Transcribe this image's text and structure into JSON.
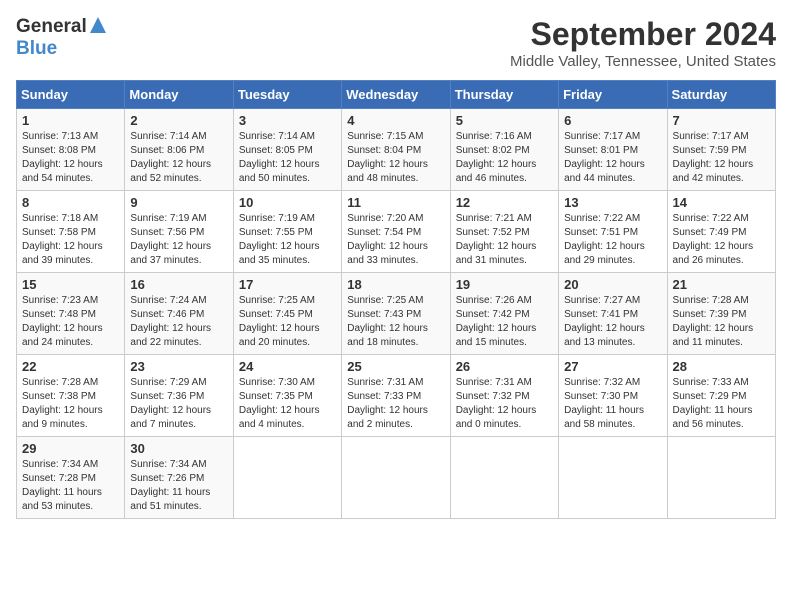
{
  "header": {
    "logo_general": "General",
    "logo_blue": "Blue",
    "title": "September 2024",
    "subtitle": "Middle Valley, Tennessee, United States"
  },
  "days_of_week": [
    "Sunday",
    "Monday",
    "Tuesday",
    "Wednesday",
    "Thursday",
    "Friday",
    "Saturday"
  ],
  "weeks": [
    [
      {
        "day": "1",
        "sunrise": "Sunrise: 7:13 AM",
        "sunset": "Sunset: 8:08 PM",
        "daylight": "Daylight: 12 hours",
        "minutes": "and 54 minutes."
      },
      {
        "day": "2",
        "sunrise": "Sunrise: 7:14 AM",
        "sunset": "Sunset: 8:06 PM",
        "daylight": "Daylight: 12 hours",
        "minutes": "and 52 minutes."
      },
      {
        "day": "3",
        "sunrise": "Sunrise: 7:14 AM",
        "sunset": "Sunset: 8:05 PM",
        "daylight": "Daylight: 12 hours",
        "minutes": "and 50 minutes."
      },
      {
        "day": "4",
        "sunrise": "Sunrise: 7:15 AM",
        "sunset": "Sunset: 8:04 PM",
        "daylight": "Daylight: 12 hours",
        "minutes": "and 48 minutes."
      },
      {
        "day": "5",
        "sunrise": "Sunrise: 7:16 AM",
        "sunset": "Sunset: 8:02 PM",
        "daylight": "Daylight: 12 hours",
        "minutes": "and 46 minutes."
      },
      {
        "day": "6",
        "sunrise": "Sunrise: 7:17 AM",
        "sunset": "Sunset: 8:01 PM",
        "daylight": "Daylight: 12 hours",
        "minutes": "and 44 minutes."
      },
      {
        "day": "7",
        "sunrise": "Sunrise: 7:17 AM",
        "sunset": "Sunset: 7:59 PM",
        "daylight": "Daylight: 12 hours",
        "minutes": "and 42 minutes."
      }
    ],
    [
      {
        "day": "8",
        "sunrise": "Sunrise: 7:18 AM",
        "sunset": "Sunset: 7:58 PM",
        "daylight": "Daylight: 12 hours",
        "minutes": "and 39 minutes."
      },
      {
        "day": "9",
        "sunrise": "Sunrise: 7:19 AM",
        "sunset": "Sunset: 7:56 PM",
        "daylight": "Daylight: 12 hours",
        "minutes": "and 37 minutes."
      },
      {
        "day": "10",
        "sunrise": "Sunrise: 7:19 AM",
        "sunset": "Sunset: 7:55 PM",
        "daylight": "Daylight: 12 hours",
        "minutes": "and 35 minutes."
      },
      {
        "day": "11",
        "sunrise": "Sunrise: 7:20 AM",
        "sunset": "Sunset: 7:54 PM",
        "daylight": "Daylight: 12 hours",
        "minutes": "and 33 minutes."
      },
      {
        "day": "12",
        "sunrise": "Sunrise: 7:21 AM",
        "sunset": "Sunset: 7:52 PM",
        "daylight": "Daylight: 12 hours",
        "minutes": "and 31 minutes."
      },
      {
        "day": "13",
        "sunrise": "Sunrise: 7:22 AM",
        "sunset": "Sunset: 7:51 PM",
        "daylight": "Daylight: 12 hours",
        "minutes": "and 29 minutes."
      },
      {
        "day": "14",
        "sunrise": "Sunrise: 7:22 AM",
        "sunset": "Sunset: 7:49 PM",
        "daylight": "Daylight: 12 hours",
        "minutes": "and 26 minutes."
      }
    ],
    [
      {
        "day": "15",
        "sunrise": "Sunrise: 7:23 AM",
        "sunset": "Sunset: 7:48 PM",
        "daylight": "Daylight: 12 hours",
        "minutes": "and 24 minutes."
      },
      {
        "day": "16",
        "sunrise": "Sunrise: 7:24 AM",
        "sunset": "Sunset: 7:46 PM",
        "daylight": "Daylight: 12 hours",
        "minutes": "and 22 minutes."
      },
      {
        "day": "17",
        "sunrise": "Sunrise: 7:25 AM",
        "sunset": "Sunset: 7:45 PM",
        "daylight": "Daylight: 12 hours",
        "minutes": "and 20 minutes."
      },
      {
        "day": "18",
        "sunrise": "Sunrise: 7:25 AM",
        "sunset": "Sunset: 7:43 PM",
        "daylight": "Daylight: 12 hours",
        "minutes": "and 18 minutes."
      },
      {
        "day": "19",
        "sunrise": "Sunrise: 7:26 AM",
        "sunset": "Sunset: 7:42 PM",
        "daylight": "Daylight: 12 hours",
        "minutes": "and 15 minutes."
      },
      {
        "day": "20",
        "sunrise": "Sunrise: 7:27 AM",
        "sunset": "Sunset: 7:41 PM",
        "daylight": "Daylight: 12 hours",
        "minutes": "and 13 minutes."
      },
      {
        "day": "21",
        "sunrise": "Sunrise: 7:28 AM",
        "sunset": "Sunset: 7:39 PM",
        "daylight": "Daylight: 12 hours",
        "minutes": "and 11 minutes."
      }
    ],
    [
      {
        "day": "22",
        "sunrise": "Sunrise: 7:28 AM",
        "sunset": "Sunset: 7:38 PM",
        "daylight": "Daylight: 12 hours",
        "minutes": "and 9 minutes."
      },
      {
        "day": "23",
        "sunrise": "Sunrise: 7:29 AM",
        "sunset": "Sunset: 7:36 PM",
        "daylight": "Daylight: 12 hours",
        "minutes": "and 7 minutes."
      },
      {
        "day": "24",
        "sunrise": "Sunrise: 7:30 AM",
        "sunset": "Sunset: 7:35 PM",
        "daylight": "Daylight: 12 hours",
        "minutes": "and 4 minutes."
      },
      {
        "day": "25",
        "sunrise": "Sunrise: 7:31 AM",
        "sunset": "Sunset: 7:33 PM",
        "daylight": "Daylight: 12 hours",
        "minutes": "and 2 minutes."
      },
      {
        "day": "26",
        "sunrise": "Sunrise: 7:31 AM",
        "sunset": "Sunset: 7:32 PM",
        "daylight": "Daylight: 12 hours",
        "minutes": "and 0 minutes."
      },
      {
        "day": "27",
        "sunrise": "Sunrise: 7:32 AM",
        "sunset": "Sunset: 7:30 PM",
        "daylight": "Daylight: 11 hours",
        "minutes": "and 58 minutes."
      },
      {
        "day": "28",
        "sunrise": "Sunrise: 7:33 AM",
        "sunset": "Sunset: 7:29 PM",
        "daylight": "Daylight: 11 hours",
        "minutes": "and 56 minutes."
      }
    ],
    [
      {
        "day": "29",
        "sunrise": "Sunrise: 7:34 AM",
        "sunset": "Sunset: 7:28 PM",
        "daylight": "Daylight: 11 hours",
        "minutes": "and 53 minutes."
      },
      {
        "day": "30",
        "sunrise": "Sunrise: 7:34 AM",
        "sunset": "Sunset: 7:26 PM",
        "daylight": "Daylight: 11 hours",
        "minutes": "and 51 minutes."
      },
      null,
      null,
      null,
      null,
      null
    ]
  ]
}
